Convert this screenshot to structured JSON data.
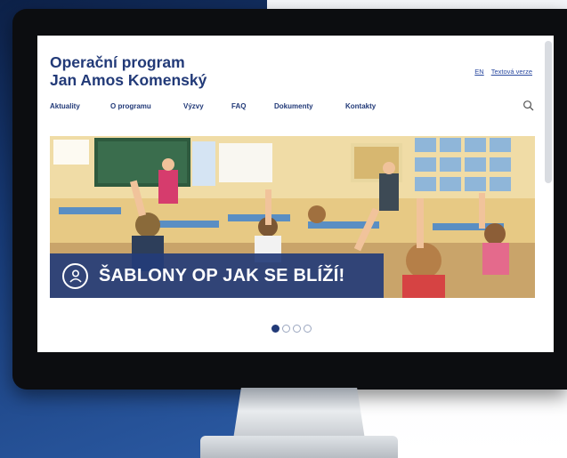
{
  "site": {
    "title_line1": "Operační program",
    "title_line2": "Jan Amos Komenský"
  },
  "top_links": {
    "lang": "EN",
    "text_version": "Textová verze"
  },
  "nav": {
    "items": [
      {
        "label": "Aktuality"
      },
      {
        "label": "O programu"
      },
      {
        "label": "Výzvy"
      },
      {
        "label": "FAQ"
      },
      {
        "label": "Dokumenty"
      },
      {
        "label": "Kontakty"
      }
    ]
  },
  "search": {
    "icon": "search-icon"
  },
  "banner": {
    "caption": "ŠABLONY OP JAK SE BLÍŽÍ!",
    "icon": "user-circle-icon"
  },
  "carousel": {
    "active_slide": 1,
    "total_slides": 4
  },
  "colors": {
    "brand_blue": "#223a78",
    "link_blue": "#2b4aa0",
    "banner_overlay": "#243c78"
  }
}
